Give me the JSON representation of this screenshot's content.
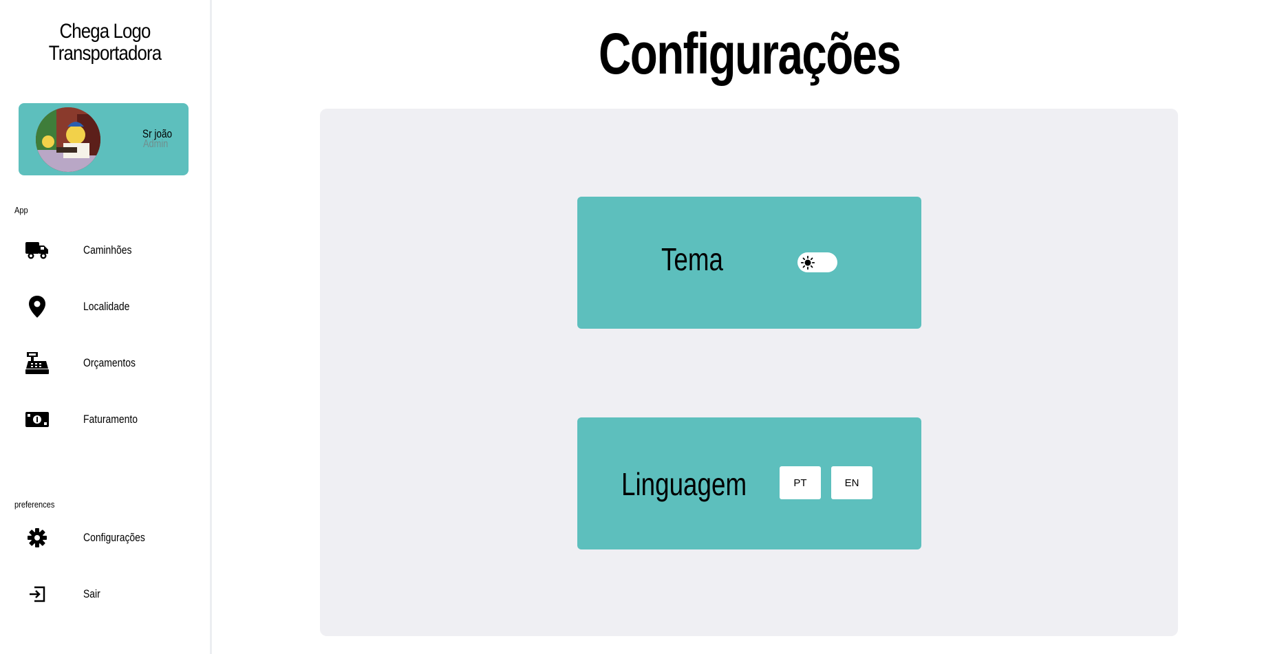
{
  "sidebar": {
    "brand_line1": "Chega Logo",
    "brand_line2": "Transportadora",
    "profile": {
      "name": "Sr joão",
      "role": "Admin",
      "avatar_icon": "avatar-cartoon-image"
    },
    "sections": {
      "app_label": "App",
      "preferences_label": "preferences"
    },
    "items": [
      {
        "label": "Caminhões",
        "icon": "truck-icon"
      },
      {
        "label": "Localidade",
        "icon": "map-pin-icon"
      },
      {
        "label": "Orçamentos",
        "icon": "cash-register-icon"
      },
      {
        "label": "Faturamento",
        "icon": "money-bill-icon"
      },
      {
        "label": "Configurações",
        "icon": "gear-icon"
      },
      {
        "label": "Sair",
        "icon": "logout-icon"
      }
    ]
  },
  "main": {
    "title": "Configurações",
    "theme": {
      "label": "Tema",
      "toggle_icon": "sun-icon",
      "state": "light"
    },
    "language": {
      "label": "Linguagem",
      "options": [
        "PT",
        "EN"
      ]
    }
  },
  "colors": {
    "accent": "#5dbfbd",
    "panel_bg": "#efeff3",
    "muted_text": "#6f8f8e"
  }
}
